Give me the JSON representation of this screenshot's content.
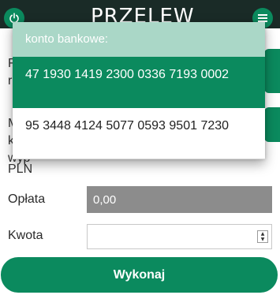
{
  "header": {
    "title": "PRZELEW",
    "left_icon": "power-icon",
    "right_icon": "hamburger-menu-icon"
  },
  "background": {
    "label_a": "F\nr",
    "label_b": "M\nk\nwyp",
    "label_c": "PLN"
  },
  "form": {
    "fee_label": "Opłata",
    "fee_value": "0,00",
    "amount_label": "Kwota",
    "amount_value": "",
    "spinner_up": "▲",
    "spinner_down": "▼"
  },
  "execute_button": {
    "label": "Wykonaj"
  },
  "dropdown": {
    "header": "konto bankowe:",
    "options": [
      {
        "label": "47 1930 1419 2300 0336 7193 0002",
        "selected": true
      },
      {
        "label": "95 3448 4124 5077 0593 9501 7230",
        "selected": false
      }
    ]
  },
  "colors": {
    "brand_green": "#0b8a5e",
    "header_dark": "#1a2b27",
    "dropdown_header": "#aad7c7",
    "fee_field_bg": "#8c8c8c"
  }
}
